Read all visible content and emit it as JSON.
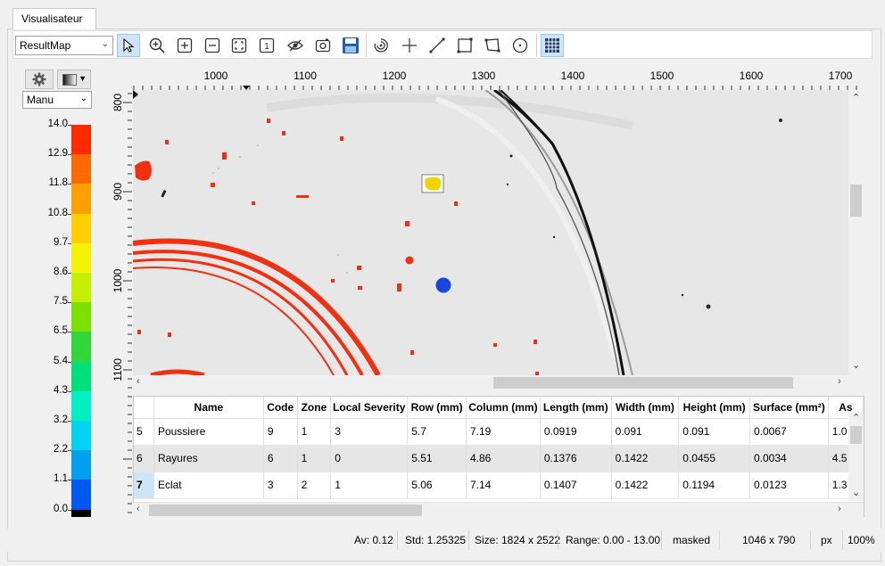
{
  "tab": {
    "label": "Visualisateur"
  },
  "toolbar": {
    "map_select": "ResultMap",
    "tools": [
      {
        "name": "pointer-icon",
        "active": true
      },
      {
        "name": "zoom-in-icon"
      },
      {
        "name": "zoom-plus-icon"
      },
      {
        "name": "zoom-minus-icon"
      },
      {
        "name": "fit-icon"
      },
      {
        "name": "actual-size-icon",
        "text": "1"
      },
      {
        "name": "hide-icon"
      },
      {
        "name": "snapshot-icon"
      },
      {
        "name": "save-icon"
      },
      {
        "name": "target-icon"
      },
      {
        "name": "crosshair-icon"
      },
      {
        "name": "line-icon"
      },
      {
        "name": "rectangle-icon"
      },
      {
        "name": "polygon-icon"
      },
      {
        "name": "circle-icon"
      },
      {
        "name": "grid-icon",
        "active": true
      }
    ]
  },
  "left_panel": {
    "mode": "Manu",
    "scale": [
      {
        "label": "14.0",
        "color": "#ff2a00"
      },
      {
        "label": "12.9",
        "color": "#ff6a00"
      },
      {
        "label": "11.8",
        "color": "#ff9f00"
      },
      {
        "label": "10.8",
        "color": "#ffcf00"
      },
      {
        "label": "9.7",
        "color": "#f6f300"
      },
      {
        "label": "8.6",
        "color": "#c4f000"
      },
      {
        "label": "7.5",
        "color": "#7ce000"
      },
      {
        "label": "6.5",
        "color": "#33d63a"
      },
      {
        "label": "5.4",
        "color": "#00e07a"
      },
      {
        "label": "4.3",
        "color": "#00f0c4"
      },
      {
        "label": "3.2",
        "color": "#00d4f2"
      },
      {
        "label": "2.2",
        "color": "#00a0f0"
      },
      {
        "label": "1.1",
        "color": "#0058f0"
      },
      {
        "label": "0.0",
        "color": "#0018e0"
      }
    ]
  },
  "ruler": {
    "top_labels": [
      "1000",
      "1100",
      "1200",
      "1300",
      "1400",
      "1500",
      "1600",
      "1700"
    ],
    "left_labels": [
      "800",
      "900",
      "1000",
      "1100"
    ]
  },
  "table": {
    "columns": [
      "",
      "Name",
      "Code",
      "Zone",
      "Local Severity",
      "Row (mm)",
      "Column (mm)",
      "Length (mm)",
      "Width (mm)",
      "Height (mm)",
      "Surface (mm²)",
      "As"
    ],
    "rows": [
      {
        "num": "5",
        "cells": [
          "Poussiere",
          "9",
          "1",
          "3",
          "5.7",
          "7.19",
          "0.0919",
          "0.091",
          "0.091",
          "0.0067",
          "1.0"
        ]
      },
      {
        "num": "6",
        "cells": [
          "Rayures",
          "6",
          "1",
          "0",
          "5.51",
          "4.86",
          "0.1376",
          "0.1422",
          "0.0455",
          "0.0034",
          "4.5"
        ]
      },
      {
        "num": "7",
        "cells": [
          "Eclat",
          "3",
          "2",
          "1",
          "5.06",
          "7.14",
          "0.1407",
          "0.1422",
          "0.1194",
          "0.0123",
          "1.3"
        ]
      }
    ],
    "selected_row": 2
  },
  "status": {
    "avg": "Av: 0.12",
    "std": "Std: 1.25325",
    "size": "Size: 1824 x 2522",
    "range": "Range: 0.00 - 13.00",
    "masked": "masked",
    "dims": "1046 x 790",
    "unit": "px",
    "zoom": "100%"
  }
}
